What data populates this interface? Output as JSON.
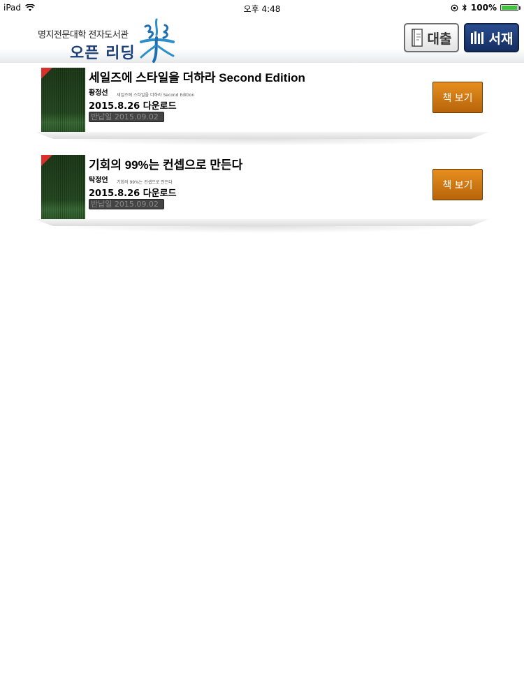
{
  "status_bar": {
    "device": "iPad",
    "time": "오후 4:48",
    "battery": "100%",
    "battery_level": 1.0
  },
  "header": {
    "logo_line1": "명지전문대학 전자도서관",
    "logo_line2": "오픈 리딩",
    "loan_button": "대출",
    "shelf_button": "서재"
  },
  "colors": {
    "brand_blue": "#1d3f78",
    "view_button": "#d67a14"
  },
  "books": [
    {
      "title": "세일즈에 스타일을 더하라 Second Edition",
      "author": "황정선",
      "subtitle": "세일즈에 스타일을 더하라 Second Edition",
      "download": "2015.8.26 다운로드",
      "return_date": "반납일 2015.09.02",
      "view_button": "책 보기"
    },
    {
      "title": "기회의 99%는 컨셉으로 만든다",
      "author": "탁정언",
      "subtitle": "기회의 99%는 컨셉으로 만든다",
      "download": "2015.8.26 다운로드",
      "return_date": "반납일 2015.09.02",
      "view_button": "책 보기"
    }
  ]
}
